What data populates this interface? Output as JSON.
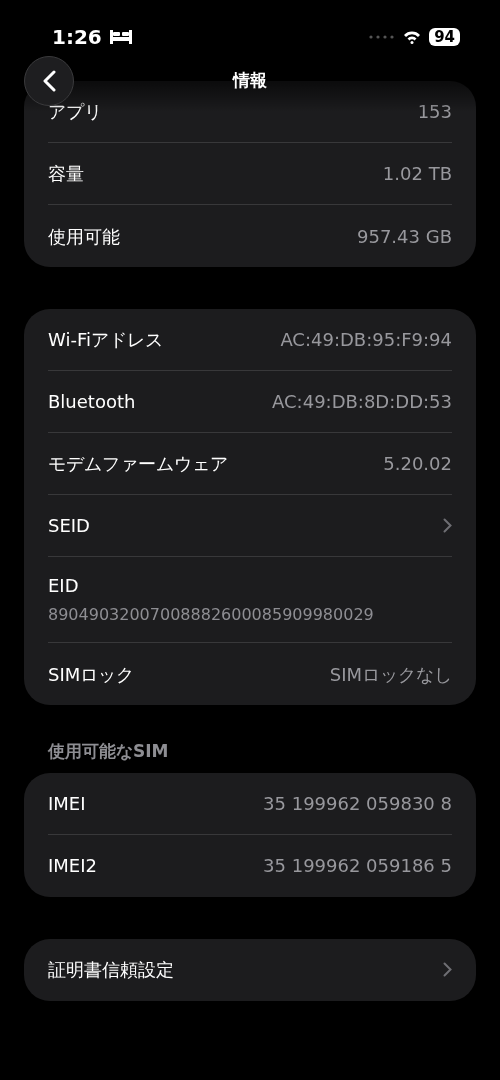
{
  "status_bar": {
    "time": "1:26",
    "battery": "94"
  },
  "nav": {
    "title": "情報"
  },
  "groups": [
    {
      "rows": [
        {
          "kind": "value",
          "label": "アプリ",
          "value": "153"
        },
        {
          "kind": "value",
          "label": "容量",
          "value": "1.02 TB"
        },
        {
          "kind": "value",
          "label": "使用可能",
          "value": "957.43 GB"
        }
      ]
    },
    {
      "rows": [
        {
          "kind": "value",
          "label": "Wi-Fiアドレス",
          "value": "AC:49:DB:95:F9:94"
        },
        {
          "kind": "value",
          "label": "Bluetooth",
          "value": "AC:49:DB:8D:DD:53"
        },
        {
          "kind": "value",
          "label": "モデムファームウェア",
          "value": "5.20.02"
        },
        {
          "kind": "chevron",
          "label": "SEID"
        },
        {
          "kind": "stacked",
          "label": "EID",
          "value": "89049032007008882600085909980029"
        },
        {
          "kind": "value",
          "label": "SIMロック",
          "value": "SIMロックなし"
        }
      ]
    },
    {
      "header": "使用可能なSIM",
      "rows": [
        {
          "kind": "value",
          "label": "IMEI",
          "value": "35 199962 059830 8"
        },
        {
          "kind": "value",
          "label": "IMEI2",
          "value": "35 199962 059186 5"
        }
      ]
    },
    {
      "rows": [
        {
          "kind": "chevron",
          "label": "証明書信頼設定"
        }
      ]
    }
  ]
}
